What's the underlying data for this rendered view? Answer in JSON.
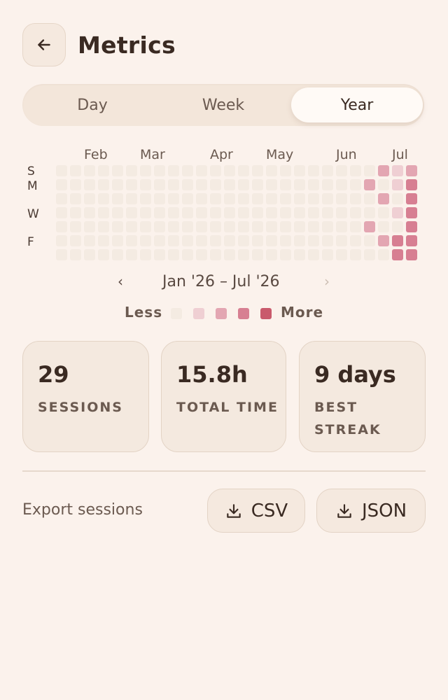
{
  "header": {
    "title": "Metrics",
    "back_icon": "arrow-left-icon"
  },
  "tabs": [
    {
      "label": "Day",
      "active": false
    },
    {
      "label": "Week",
      "active": false
    },
    {
      "label": "Year",
      "active": true
    }
  ],
  "heatmap": {
    "months": [
      "Feb",
      "Mar",
      "Apr",
      "May",
      "Jun",
      "Jul"
    ],
    "day_labels": [
      "S",
      "M",
      "W",
      "F"
    ],
    "range_label": "Jan '26 – Jul '26",
    "prev_icon": "chevron-left-icon",
    "next_icon": "chevron-right-icon",
    "legend_less": "Less",
    "legend_more": "More",
    "levels": [
      "#f4ebe2",
      "#efcfd3",
      "#e3a6b2",
      "#d77f92",
      "#c95a6c"
    ],
    "weeks": 26,
    "active_cells": [
      {
        "week": 23,
        "day": 0,
        "level": 2
      },
      {
        "week": 24,
        "day": 0,
        "level": 1
      },
      {
        "week": 25,
        "day": 0,
        "level": 2
      },
      {
        "week": 22,
        "day": 1,
        "level": 2
      },
      {
        "week": 24,
        "day": 1,
        "level": 1
      },
      {
        "week": 25,
        "day": 1,
        "level": 3
      },
      {
        "week": 23,
        "day": 2,
        "level": 2
      },
      {
        "week": 25,
        "day": 2,
        "level": 3
      },
      {
        "week": 24,
        "day": 3,
        "level": 1
      },
      {
        "week": 25,
        "day": 3,
        "level": 3
      },
      {
        "week": 22,
        "day": 4,
        "level": 2
      },
      {
        "week": 25,
        "day": 4,
        "level": 3
      },
      {
        "week": 23,
        "day": 5,
        "level": 2
      },
      {
        "week": 24,
        "day": 5,
        "level": 3
      },
      {
        "week": 25,
        "day": 5,
        "level": 3
      },
      {
        "week": 24,
        "day": 6,
        "level": 3
      },
      {
        "week": 25,
        "day": 6,
        "level": 3
      }
    ]
  },
  "stats": [
    {
      "value": "29",
      "label": "SESSIONS"
    },
    {
      "value": "15.8h",
      "label": "TOTAL TIME"
    },
    {
      "value": "9 days",
      "label": "BEST STREAK"
    }
  ],
  "export": {
    "label": "Export sessions",
    "buttons": [
      {
        "label": "CSV",
        "icon": "download-icon"
      },
      {
        "label": "JSON",
        "icon": "download-icon"
      }
    ]
  }
}
